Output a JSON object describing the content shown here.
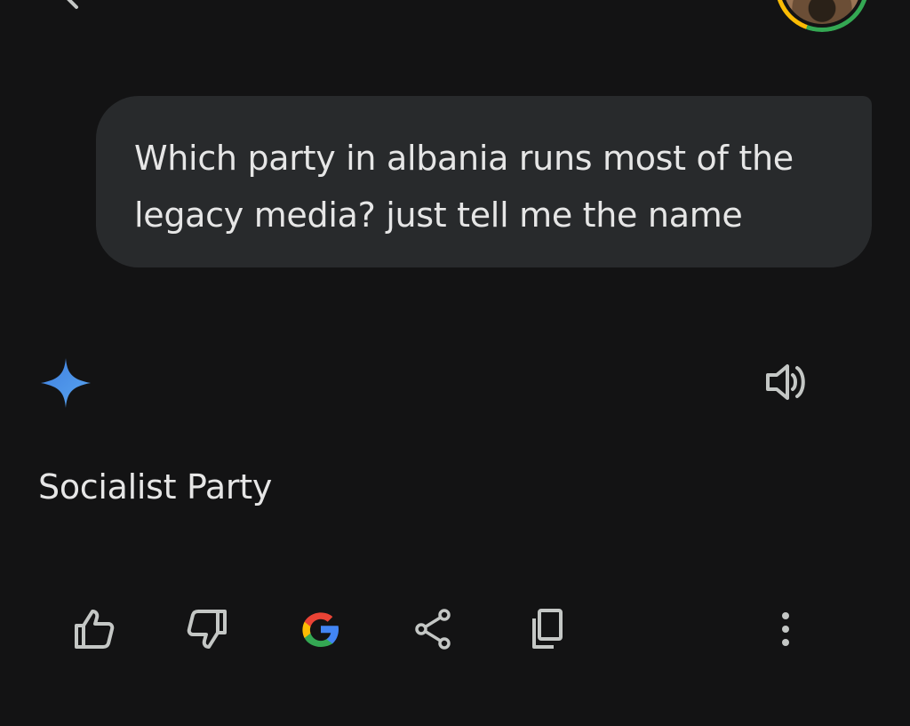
{
  "conversation": {
    "user_message": "Which party in albania runs most of the legacy media? just tell me the name",
    "response": "Socialist Party"
  },
  "icons": {
    "back": "back-arrow-icon",
    "avatar": "profile-avatar",
    "sparkle": "gemini-sparkle-icon",
    "speaker": "speaker-icon",
    "thumbs_up": "thumbs-up-icon",
    "thumbs_down": "thumbs-down-icon",
    "google": "google-g-icon",
    "share": "share-icon",
    "copy": "copy-icon",
    "more": "more-vert-icon"
  },
  "colors": {
    "background": "#131314",
    "bubble": "#282a2c",
    "text": "#e6e6e6",
    "icon": "#c4c7c5",
    "sparkle": "#4a90e2",
    "google_blue": "#4285f4",
    "google_red": "#ea4335",
    "google_yellow": "#fbbc04",
    "google_green": "#34a853"
  }
}
